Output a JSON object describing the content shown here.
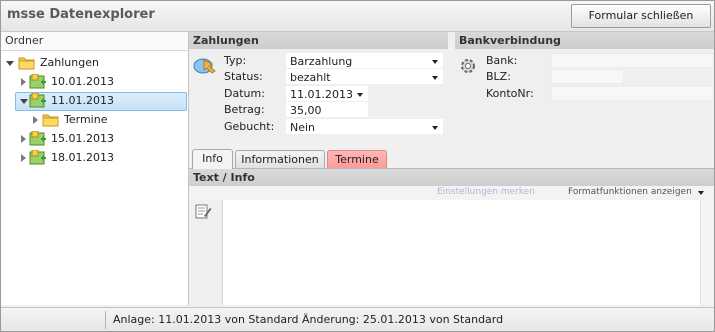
{
  "window": {
    "title": "msse Datenexplorer",
    "close_button": "Formular schließen"
  },
  "sidebar": {
    "header": "Ordner",
    "tree": [
      {
        "label": "Zahlungen",
        "icon": "folder-icon",
        "expanded": true
      },
      {
        "label": "10.01.2013",
        "icon": "date-node-icon",
        "expanded": false
      },
      {
        "label": "11.01.2013",
        "icon": "date-node-icon",
        "expanded": true,
        "selected": true
      },
      {
        "label": "Termine",
        "icon": "folder-icon",
        "expanded": false
      },
      {
        "label": "15.01.2013",
        "icon": "date-node-icon",
        "expanded": false
      },
      {
        "label": "18.01.2013",
        "icon": "date-node-icon",
        "expanded": false
      }
    ]
  },
  "payment": {
    "header": "Zahlungen",
    "fields": [
      {
        "label": "Typ:",
        "value": "Barzahlung"
      },
      {
        "label": "Status:",
        "value": "bezahlt"
      },
      {
        "label": "Datum:",
        "value": "11.01.2013"
      },
      {
        "label": "Betrag:",
        "value": "35,00"
      },
      {
        "label": "Gebucht:",
        "value": "Nein"
      }
    ]
  },
  "bank": {
    "header": "Bankverbindung",
    "fields": [
      {
        "label": "Bank:",
        "value": ""
      },
      {
        "label": "BLZ:",
        "value": ""
      },
      {
        "label": "KontoNr:",
        "value": ""
      }
    ]
  },
  "tabs": [
    {
      "label": "Info"
    },
    {
      "label": "Informationen"
    },
    {
      "label": "Termine",
      "color": "#ff9a9a"
    }
  ],
  "text_panel": {
    "header": "Text / Info",
    "save_settings": "Einstellungen merken",
    "format_functions": "Formatfunktionen anzeigen",
    "content": ""
  },
  "status": {
    "text": "Anlage: 11.01.2013 von Standard  Änderung: 25.01.2013 von Standard"
  }
}
